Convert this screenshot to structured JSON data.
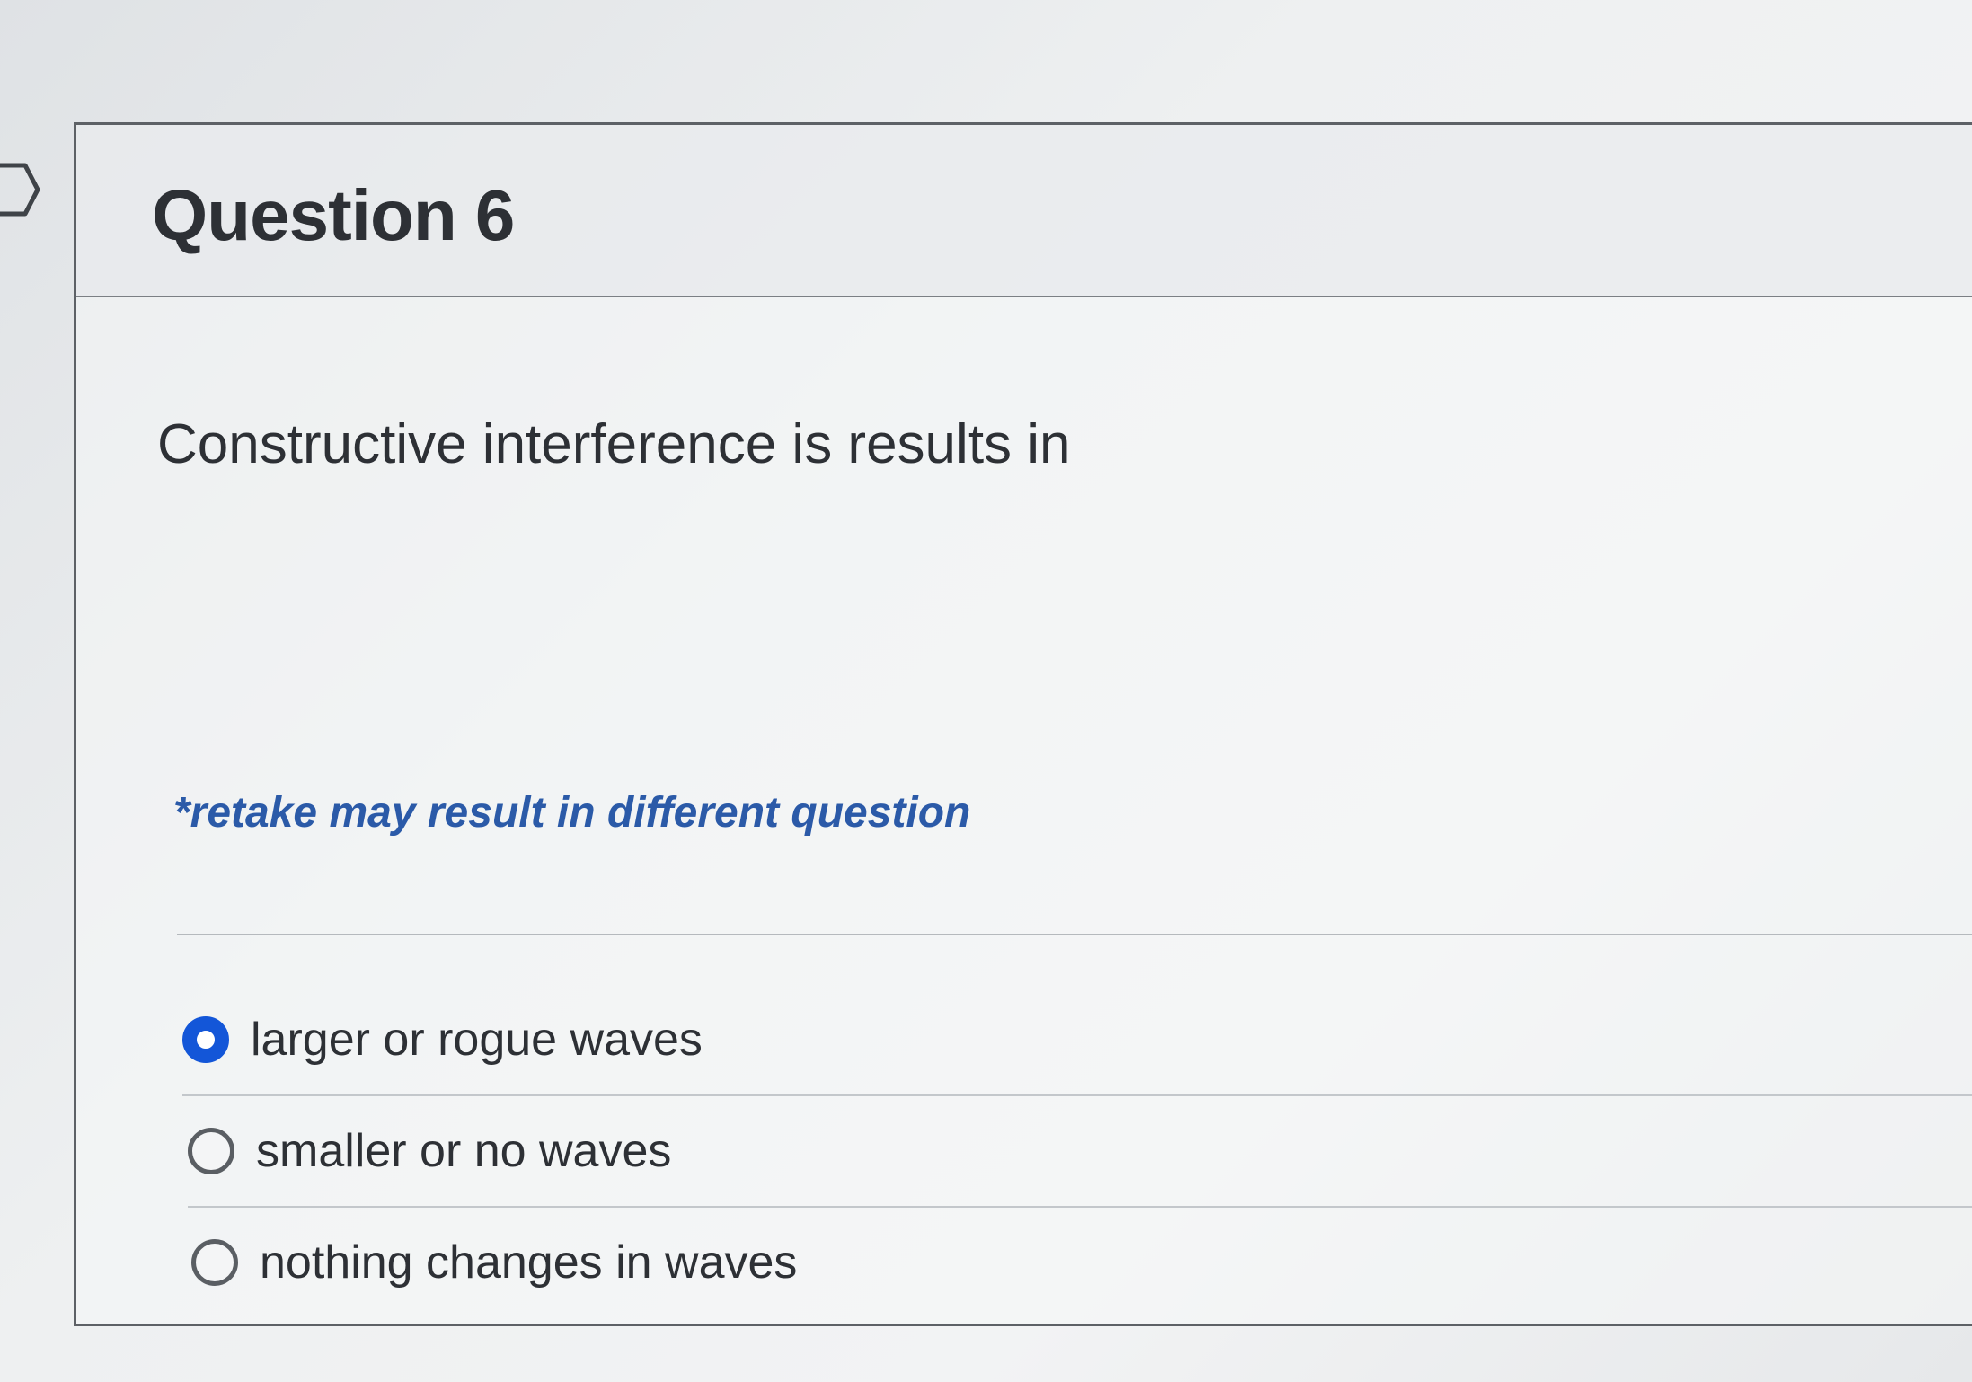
{
  "question": {
    "title": "Question 6",
    "text": "Constructive interference is results in",
    "note": "*retake may result in different question"
  },
  "answers": [
    {
      "label": "larger or rogue waves",
      "selected": true
    },
    {
      "label": "smaller or no waves",
      "selected": false
    },
    {
      "label": "nothing changes in waves",
      "selected": false
    }
  ],
  "colors": {
    "accent": "#1356d8",
    "note": "#2b5aa8",
    "text": "#2d3035"
  },
  "icons": {
    "flag": "flag-marker-icon",
    "radio_selected": "radio-selected-icon",
    "radio_unselected": "radio-unselected-icon"
  }
}
